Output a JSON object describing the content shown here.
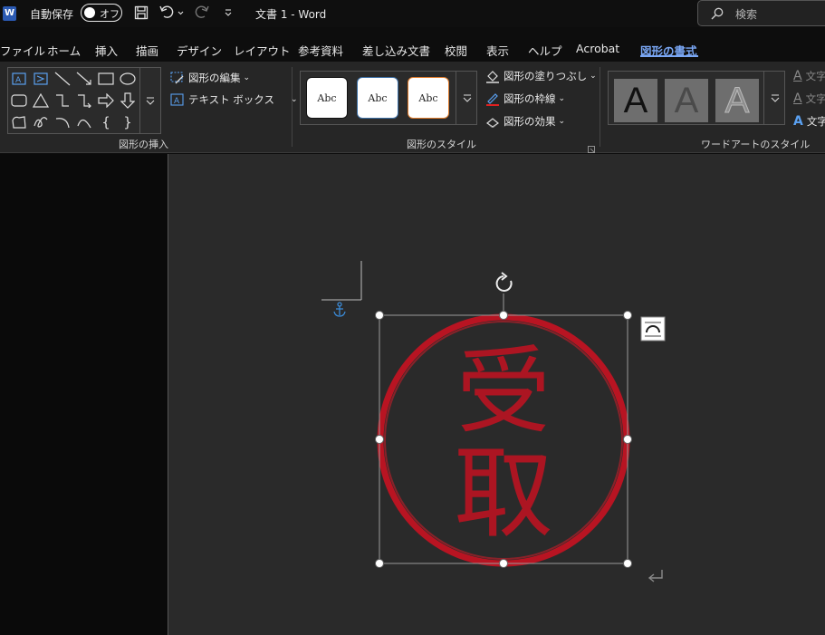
{
  "titlebar": {
    "app_icon_letter": "W",
    "autosave_label": "自動保存",
    "autosave_state": "オフ",
    "doc_title": "文書 1  -  Word",
    "search_placeholder": "検索"
  },
  "tabs": [
    {
      "label": "ファイル"
    },
    {
      "label": "ホーム"
    },
    {
      "label": "挿入"
    },
    {
      "label": "描画"
    },
    {
      "label": "デザイン"
    },
    {
      "label": "レイアウト"
    },
    {
      "label": "参考資料"
    },
    {
      "label": "差し込み文書"
    },
    {
      "label": "校閲"
    },
    {
      "label": "表示"
    },
    {
      "label": "ヘルプ"
    },
    {
      "label": "Acrobat"
    },
    {
      "label": "図形の書式",
      "active": true
    }
  ],
  "ribbon": {
    "insert_shapes": {
      "label": "図形の挿入",
      "edit_shape": "図形の編集",
      "text_box": "テキスト ボックス"
    },
    "shape_styles": {
      "label": "図形のスタイル",
      "preset_text": "Abc",
      "fill": "図形の塗りつぶし",
      "outline": "図形の枠線",
      "effects": "図形の効果"
    },
    "wordart": {
      "label": "ワードアートのスタイル",
      "preset_letter": "A",
      "text_fill": "文字",
      "text_outline": "文字",
      "text_effects": "文字"
    }
  },
  "stamp": {
    "char_top": "受",
    "char_bottom": "取",
    "color": "#b81422"
  },
  "colors": {
    "accent": "#7aa7f5",
    "anchor": "#3b8ad6",
    "outline_red": "#e02020"
  }
}
